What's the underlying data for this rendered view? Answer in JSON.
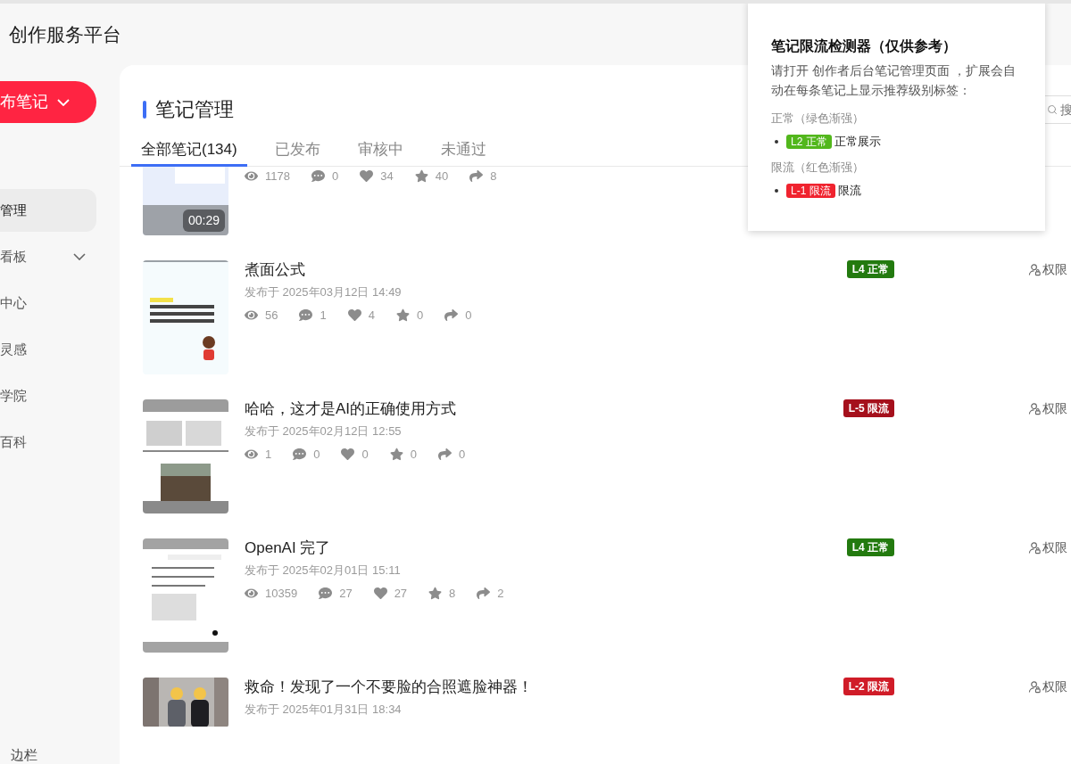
{
  "header": {
    "title": "创作服务平台"
  },
  "sidebar": {
    "publish_button": "布笔记",
    "items": [
      {
        "label": "管理",
        "selected": true,
        "expandable": false
      },
      {
        "label": "看板",
        "selected": false,
        "expandable": true
      },
      {
        "label": "中心",
        "selected": false,
        "expandable": false
      },
      {
        "label": "灵感",
        "selected": false,
        "expandable": false
      },
      {
        "label": "学院",
        "selected": false,
        "expandable": false
      },
      {
        "label": "百科",
        "selected": false,
        "expandable": false
      }
    ],
    "collapse_label": "边栏"
  },
  "page": {
    "title": "笔记管理",
    "search": {
      "placeholder": "搜"
    },
    "tabs": [
      {
        "label": "全部笔记(134)",
        "selected": true
      },
      {
        "label": "已发布",
        "selected": false
      },
      {
        "label": "审核中",
        "selected": false
      },
      {
        "label": "未通过",
        "selected": false
      }
    ]
  },
  "notes": [
    {
      "thumbnail": {
        "kind": "video",
        "duration": "00:29"
      },
      "stats": [
        {
          "kind": "views",
          "value": "1178"
        },
        {
          "kind": "comments",
          "value": "0"
        },
        {
          "kind": "likes",
          "value": "34"
        },
        {
          "kind": "collects",
          "value": "40"
        },
        {
          "kind": "shares",
          "value": "8"
        }
      ]
    },
    {
      "thumbnail": {
        "kind": "comic"
      },
      "title": "煮面公式",
      "date": "发布于 2025年03月12日 14:49",
      "badge": {
        "label": "L4 正常",
        "color": "#237a0f"
      },
      "action": "权限",
      "stats": [
        {
          "kind": "views",
          "value": "56"
        },
        {
          "kind": "comments",
          "value": "1"
        },
        {
          "kind": "likes",
          "value": "4"
        },
        {
          "kind": "collects",
          "value": "0"
        },
        {
          "kind": "shares",
          "value": "0"
        }
      ]
    },
    {
      "thumbnail": {
        "kind": "meme"
      },
      "title": "哈哈，这才是AI的正确使用方式",
      "date": "发布于 2025年02月12日 12:55",
      "badge": {
        "label": "L-5 限流",
        "color": "#a5101c"
      },
      "action": "权限",
      "stats": [
        {
          "kind": "views",
          "value": "1"
        },
        {
          "kind": "comments",
          "value": "0"
        },
        {
          "kind": "likes",
          "value": "0"
        },
        {
          "kind": "collects",
          "value": "0"
        },
        {
          "kind": "shares",
          "value": "0"
        }
      ]
    },
    {
      "thumbnail": {
        "kind": "document"
      },
      "title": "OpenAI 完了",
      "date": "发布于 2025年02月01日 15:11",
      "badge": {
        "label": "L4 正常",
        "color": "#237a0f"
      },
      "action": "权限",
      "stats": [
        {
          "kind": "views",
          "value": "10359"
        },
        {
          "kind": "comments",
          "value": "27"
        },
        {
          "kind": "likes",
          "value": "27"
        },
        {
          "kind": "collects",
          "value": "8"
        },
        {
          "kind": "shares",
          "value": "2"
        }
      ]
    },
    {
      "title": "救命！发现了一个不要脸的合照遮脸神器！",
      "date": "发布于 2025年01月31日 18:34",
      "badge": {
        "label": "L-2 限流",
        "color": "#d01c28"
      },
      "action": "权限"
    }
  ],
  "popup": {
    "title": "笔记限流检测器（仅供参考）",
    "description": "请打开 创作者后台笔记管理页面 ，扩展会自动在每条笔记上显示推荐级别标签：",
    "sections": [
      {
        "heading": "正常（绿色渐强）",
        "items": [
          {
            "badge": "L2 正常",
            "color": "#52b71c",
            "text": "正常展示"
          }
        ]
      },
      {
        "heading": "限流（红色渐强）",
        "items": [
          {
            "badge": "L-1 限流",
            "color": "#f0232f",
            "text": "限流"
          }
        ]
      }
    ]
  }
}
